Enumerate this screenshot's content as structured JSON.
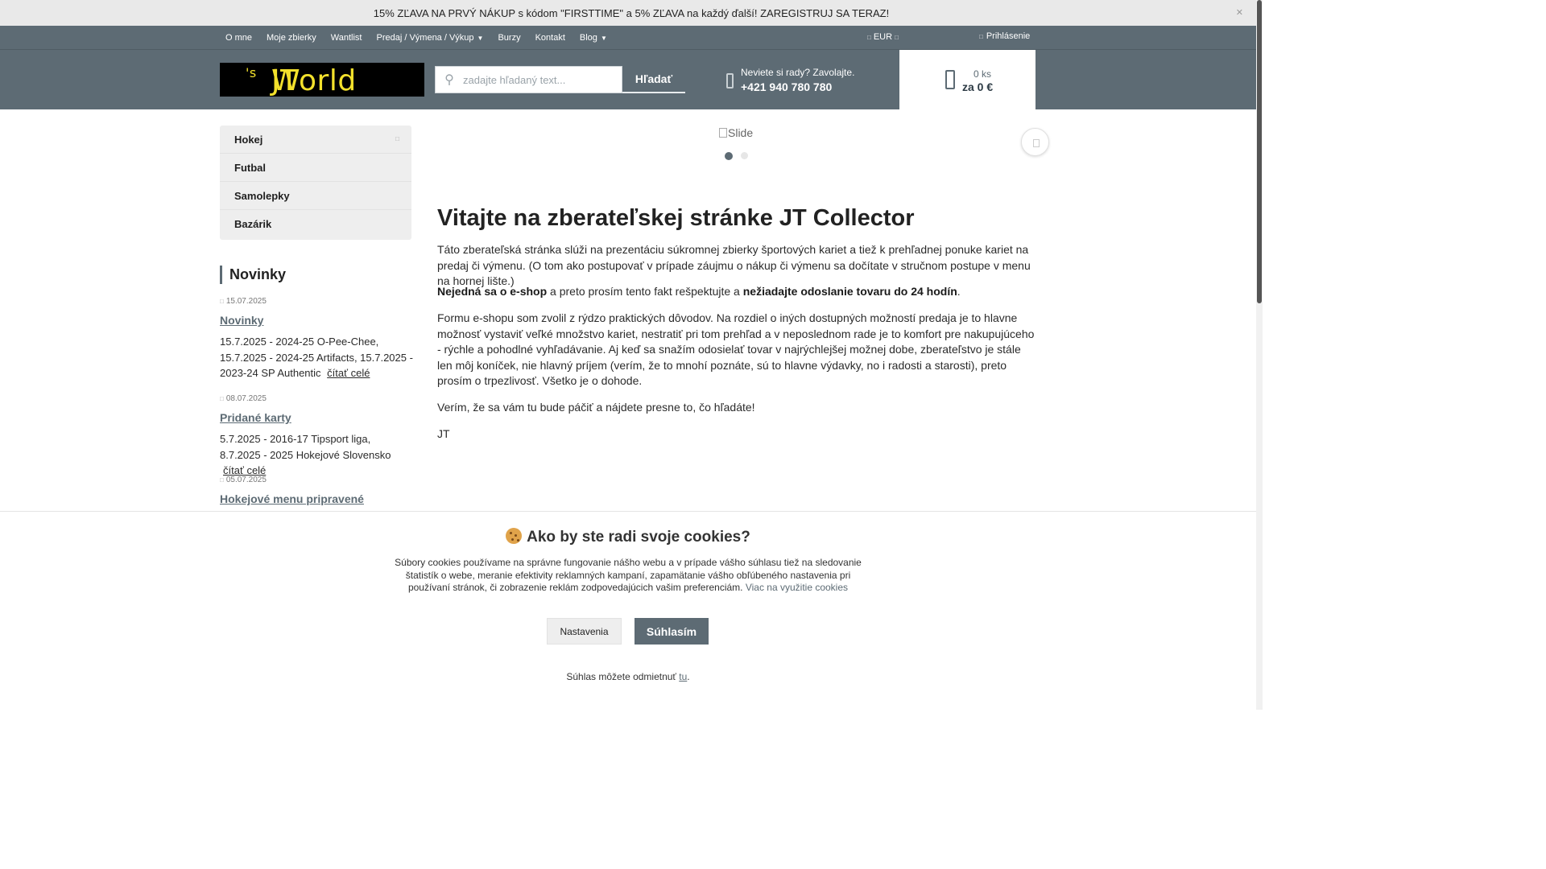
{
  "promo": {
    "text": "15% ZĽAVA NA PRVÝ NÁKUP s kódom \"FIRSTTIME\" a 5% ZĽAVA na každý ďalší! ZAREGISTRUJ SA TERAZ!"
  },
  "top_nav": {
    "items": [
      {
        "label": "O mne"
      },
      {
        "label": "Moje zbierky"
      },
      {
        "label": "Wantlist"
      },
      {
        "label": "Predaj / Výmena / Výkup"
      },
      {
        "label": "Burzy"
      },
      {
        "label": "Kontakt"
      },
      {
        "label": "Blog"
      }
    ],
    "currency": "EUR",
    "login": "Prihlásenie"
  },
  "header": {
    "logo_text": "JT",
    "logo_sup": "'s",
    "logo_text2": "World",
    "search_placeholder": "zadajte hľadaný text...",
    "search_button": "Hľadať",
    "phone_question": "Neviete si rady? Zavolajte.",
    "phone_number": "+421 940 780 780",
    "cart_count": "0 ks",
    "cart_total": "za 0 €"
  },
  "categories": [
    {
      "label": "Hokej"
    },
    {
      "label": "Futbal"
    },
    {
      "label": "Samolepky"
    },
    {
      "label": "Bazárik"
    }
  ],
  "news": {
    "title": "Novinky",
    "read_more": "čítať celé",
    "items": [
      {
        "date": "15.07.2025",
        "title": "Novinky",
        "text": "15.7.2025 - 2024-25 O-Pee-Chee, 15.7.2025 - 2024-25 Artifacts, 15.7.2025 - 2023-24 SP Authentic"
      },
      {
        "date": "08.07.2025",
        "title": "Pridané karty",
        "text": "5.7.2025 - 2016-17 Tipsport liga, 8.7.2025 - 2025 Hokejové Slovensko"
      },
      {
        "date": "05.07.2025",
        "title": "Hokejové menu pripravené",
        "text": ""
      }
    ]
  },
  "slider": {
    "alt": "Slide"
  },
  "main": {
    "title": "Vitajte na zberateľskej stránke JT Collector",
    "p1": "Táto zberateľská stránka slúži na prezentáciu súkromnej zbierky športových kariet a tiež k prehľadnej ponuke kariet na predaj či výmenu. (O tom ako postupovať v prípade záujmu o nákup či výmenu sa dočítate v stručnom postupe v menu na hornej lište.)",
    "p2_bold1": "Nejedná sa o e-shop",
    "p2_mid": " a preto prosím tento fakt rešpektujte a ",
    "p2_bold2": "nežiadajte odoslanie tovaru do 24 hodín",
    "p2_end": ".",
    "p3": "Formu e-shopu som zvolil z rýdzo praktických dôvodov. Na rozdiel o iných dostupných možností predaja je to hlavne možnosť vystaviť veľké množstvo kariet, nestratiť pri tom prehľad a v neposlednom rade je to komfort pre nakupujúceho - rýchle a pohodlné vyhľadávanie. Aj keď sa snažím odosielať tovar v najrýchlejšej možnej dobe, zberateľstvo je stále len môj koníček, nie hlavný príjem (verím, že to mnohí poznáte, sú to hlavne výdavky, no i radosti a starosti), preto prosím o trpezlivosť. Všetko je o dohode.",
    "p4": "Verím, že sa vám tu bude páčiť a nájdete presne to, čo hľadáte!",
    "p5": "JT"
  },
  "cookie": {
    "title": "Ako by ste radi svoje cookies?",
    "text": "Súbory cookies používame na správne fungovanie nášho webu a v prípade vášho súhlasu tiež na sledovanie štatistík o webe, meranie efektivity reklamných kampaní, zapamätanie vášho obľúbeného nastavenia pri používaní stránok, či zobrazenie reklám zodpovedajúcich vašim preferenciám.",
    "link": "Viac na využitie cookies",
    "settings_button": "Nastavenia",
    "agree_button": "Súhlasím",
    "decline_text": "Súhlas môžete odmietnuť",
    "decline_link": "tu"
  }
}
